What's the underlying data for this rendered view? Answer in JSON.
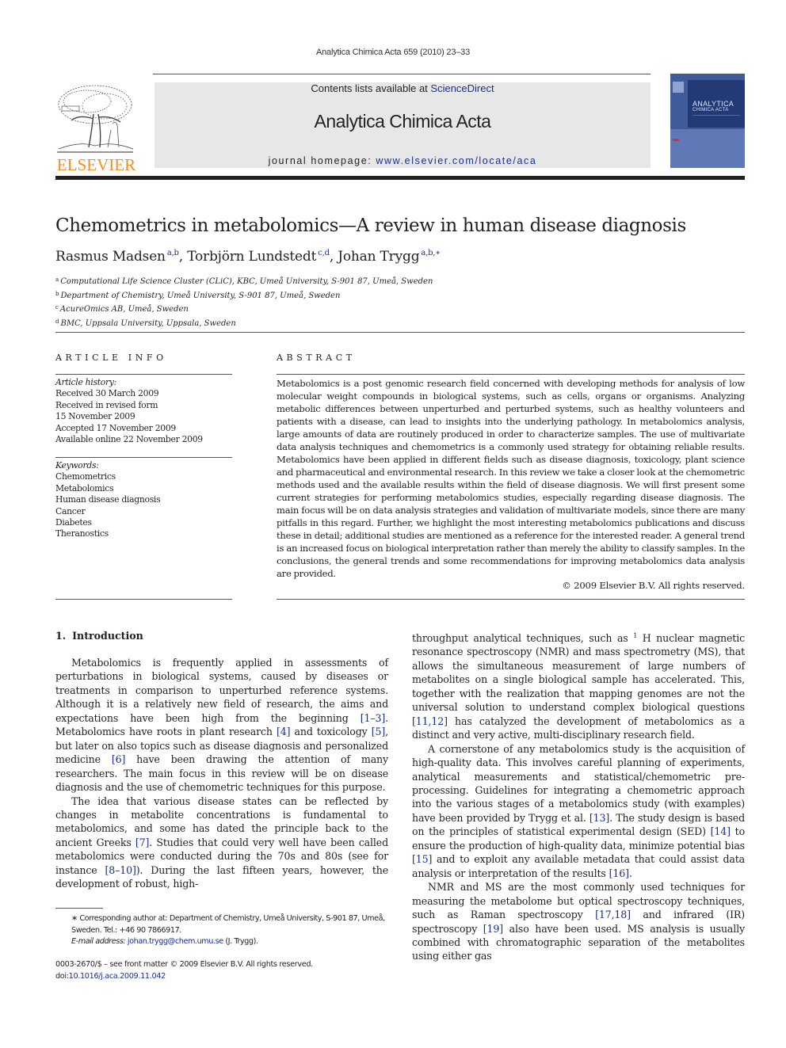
{
  "header": {
    "running_head": "Analytica Chimica Acta 659 (2010) 23–33",
    "contents_prefix": "Contents lists available at ",
    "contents_link": "ScienceDirect",
    "journal_name": "Analytica Chimica Acta",
    "homepage_prefix": "journal homepage: ",
    "homepage_url": "www.elsevier.com/locate/aca",
    "publisher_wordmark": "ELSEVIER",
    "cover_title_line1": "ANALYTICA",
    "cover_title_line2": "CHIMICA ACTA",
    "colors": {
      "publisher_orange": "#f28f1e",
      "link_blue": "#1b2f8d",
      "banner_gray": "#e7e7e8",
      "cover_blue": "#3f5b9c"
    }
  },
  "article": {
    "title": "Chemometrics in metabolomics—A review in human disease diagnosis",
    "authors": [
      {
        "name": "Rasmus Madsen",
        "sup": "a,b",
        "sep": ", "
      },
      {
        "name": "Torbjörn Lundstedt",
        "sup": "c,d",
        "sep": ", "
      },
      {
        "name": "Johan Trygg",
        "sup": "a,b,∗",
        "sep": ""
      }
    ],
    "affiliations": [
      {
        "key": "a",
        "text": "Computational Life Science Cluster (CLiC), KBC, Umeå University, S-901 87, Umeå, Sweden"
      },
      {
        "key": "b",
        "text": "Department of Chemistry, Umeå University, S-901 87, Umeå, Sweden"
      },
      {
        "key": "c",
        "text": "AcureOmics AB, Umeå, Sweden"
      },
      {
        "key": "d",
        "text": "BMC, Uppsala University, Uppsala, Sweden"
      }
    ]
  },
  "article_info": {
    "heading": "ARTICLE INFO",
    "history_label": "Article history:",
    "history": [
      "Received 30 March 2009",
      "Received in revised form",
      "15 November 2009",
      "Accepted 17 November 2009",
      "Available online 22 November 2009"
    ],
    "keywords_label": "Keywords:",
    "keywords": [
      "Chemometrics",
      "Metabolomics",
      "Human disease diagnosis",
      "Cancer",
      "Diabetes",
      "Theranostics"
    ]
  },
  "abstract": {
    "heading": "ABSTRACT",
    "text": "Metabolomics is a post genomic research field concerned with developing methods for analysis of low molecular weight compounds in biological systems, such as cells, organs or organisms. Analyzing metabolic differences between unperturbed and perturbed systems, such as healthy volunteers and patients with a disease, can lead to insights into the underlying pathology. In metabolomics analysis, large amounts of data are routinely produced in order to characterize samples. The use of multivariate data analysis techniques and chemometrics is a commonly used strategy for obtaining reliable results. Metabolomics have been applied in different fields such as disease diagnosis, toxicology, plant science and pharmaceutical and environmental research. In this review we take a closer look at the chemometric methods used and the available results within the field of disease diagnosis. We will first present some current strategies for performing metabolomics studies, especially regarding disease diagnosis. The main focus will be on data analysis strategies and validation of multivariate models, since there are many pitfalls in this regard. Further, we highlight the most interesting metabolomics publications and discuss these in detail; additional studies are mentioned as a reference for the interested reader. A general trend is an increased focus on biological interpretation rather than merely the ability to classify samples. In the conclusions, the general trends and some recommendations for improving metabolomics data analysis are provided.",
    "copyright": "© 2009 Elsevier B.V. All rights reserved."
  },
  "body": {
    "section_number": "1.",
    "section_title": "Introduction",
    "paragraphs": [
      [
        {
          "t": "Metabolomics is frequently applied in assessments of perturbations in biological systems, caused by diseases or treatments in comparison to unperturbed reference systems. Although it is a relatively new field of research, the aims and expectations have been high from the beginning "
        },
        {
          "r": "[1–3]"
        },
        {
          "t": ". Metabolomics have roots in plant research "
        },
        {
          "r": "[4]"
        },
        {
          "t": " and toxicology "
        },
        {
          "r": "[5]"
        },
        {
          "t": ", but later on also topics such as disease diagnosis and personalized medicine "
        },
        {
          "r": "[6]"
        },
        {
          "t": " have been drawing the attention of many researchers. The main focus in this review will be on disease diagnosis and the use of chemometric techniques for this purpose."
        }
      ],
      [
        {
          "t": "The idea that various disease states can be reflected by changes in metabolite concentrations is fundamental to metabolomics, and some has dated the principle back to the ancient Greeks "
        },
        {
          "r": "[7]"
        },
        {
          "t": ". Studies that could very well have been called metabolomics were conducted during the 70s and 80s (see for instance "
        },
        {
          "r": "[8–10]"
        },
        {
          "t": "). During the last fifteen years, however, the development of robust, high-"
        }
      ]
    ],
    "right_paragraphs": [
      [
        {
          "t": "throughput analytical techniques, such as "
        },
        {
          "s": "1"
        },
        {
          "t": " H nuclear magnetic resonance spectroscopy (NMR) and mass spectrometry (MS), that allows the simultaneous measurement of large numbers of metabolites on a single biological sample has accelerated. This, together with the realization that mapping genomes are not the universal solution to understand complex biological questions "
        },
        {
          "r": "[11,12]"
        },
        {
          "t": " has catalyzed the development of metabolomics as a distinct and very active, multi-disciplinary research field."
        }
      ],
      [
        {
          "t": "A cornerstone of any metabolomics study is the acquisition of high-quality data. This involves careful planning of experiments, analytical measurements and statistical/chemometric pre-processing. Guidelines for integrating a chemometric approach into the various stages of a metabolomics study (with examples) have been provided by Trygg et al. "
        },
        {
          "r": "[13]"
        },
        {
          "t": ". The study design is based on the principles of statistical experimental design (SED) "
        },
        {
          "r": "[14]"
        },
        {
          "t": " to ensure the production of high-quality data, minimize potential bias "
        },
        {
          "r": "[15]"
        },
        {
          "t": " and to exploit any available metadata that could assist data analysis or interpretation of the results "
        },
        {
          "r": "[16]"
        },
        {
          "t": "."
        }
      ],
      [
        {
          "t": "NMR and MS are the most commonly used techniques for measuring the metabolome but optical spectroscopy techniques, such as Raman spectroscopy "
        },
        {
          "r": "[17,18]"
        },
        {
          "t": " and infrared (IR) spectroscopy "
        },
        {
          "r": "[19]"
        },
        {
          "t": " also have been used. MS analysis is usually combined with chromatographic separation of the metabolites using either gas"
        }
      ]
    ]
  },
  "footnotes": {
    "corresponding_mark": "∗",
    "corresponding_text": "Corresponding author at: Department of Chemistry, Umeå University, S-901 87, Umeå, Sweden. Tel.: +46 90 7866917.",
    "email_label": "E-mail address:",
    "email": "johan.trygg@chem.umu.se",
    "email_suffix": " (J. Trygg).",
    "issn_line": "0003-2670/$ – see front matter © 2009 Elsevier B.V. All rights reserved.",
    "doi_prefix": "doi:",
    "doi": "10.1016/j.aca.2009.11.042"
  }
}
